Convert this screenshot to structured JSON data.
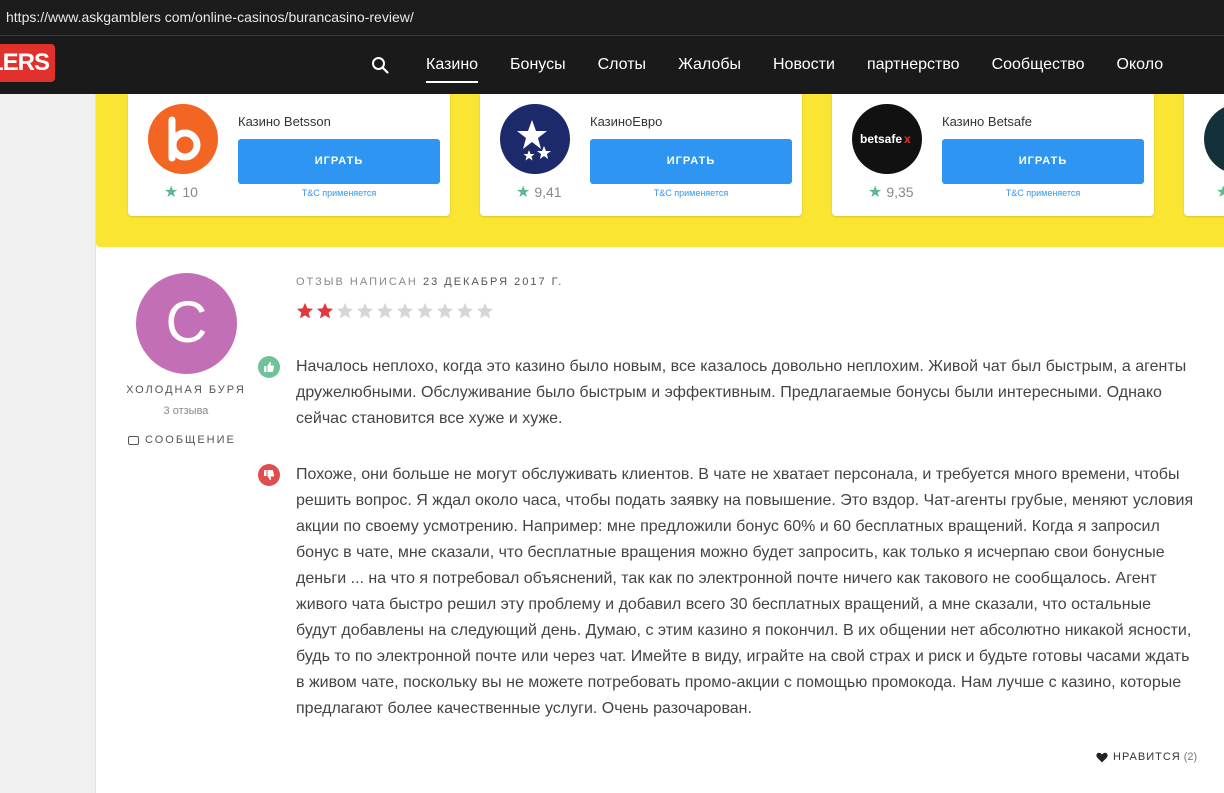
{
  "browser": {
    "url": "https://www.askgamblers com/online-casinos/burancasino-review/"
  },
  "header": {
    "logo_text": "LERS",
    "nav": [
      "Казино",
      "Бонусы",
      "Слоты",
      "Жалобы",
      "Новости",
      "партнерство",
      "Сообщество",
      "Около"
    ],
    "active": "Казино"
  },
  "casinos": [
    {
      "name": "Казино Betsson",
      "button": "ИГРАТЬ",
      "tc": "T&C применяется",
      "rating": "10",
      "logo_color": "#f26522"
    },
    {
      "name": "КазиноЕвро",
      "button": "ИГРАТЬ",
      "tc": "T&C применяется",
      "rating": "9,41",
      "logo_color": "#1c2a6b"
    },
    {
      "name": "Казино Betsafe",
      "button": "ИГРАТЬ",
      "tc": "T&C применяется",
      "rating": "9,35",
      "logo_color": "#111111",
      "logo_text": "betsafe"
    }
  ],
  "review": {
    "author": "ХОЛОДНАЯ БУРЯ",
    "avatar_letter": "C",
    "review_count": "3 отзыва",
    "message_label": "СООБЩЕНИЕ",
    "date_prefix": "ОТЗЫВ НАПИСАН",
    "date": "23 ДЕКАБРЯ 2017 Г.",
    "rating_stars": 2,
    "rating_max": 10,
    "pros": "Началось неплохо, когда это казино было новым, все казалось довольно неплохим. Живой чат был быстрым, а агенты дружелюбными. Обслуживание было быстрым и эффективным. Предлагаемые бонусы были интересными. Однако сейчас становится все хуже и хуже.",
    "cons": "Похоже, они больше не могут обслуживать клиентов. В чате не хватает персонала, и требуется много времени, чтобы решить вопрос. Я ждал около часа, чтобы подать заявку на повышение. Это вздор. Чат-агенты грубые, меняют условия акции по своему усмотрению. Например: мне предложили бонус 60% и 60 бесплатных вращений. Когда я запросил бонус в чате, мне сказали, что бесплатные вращения можно будет запросить, как только я исчерпаю свои бонусные деньги ... на что я потребовал объяснений, так как по электронной почте ничего как такового не сообщалось. Агент живого чата быстро решил эту проблему и добавил всего 30 бесплатных вращений, а мне сказали, что остальные будут добавлены на следующий день. Думаю, с этим казино я покончил. В их общении нет абсолютно никакой ясности, будь то по электронной почте или через чат. Имейте в виду, играйте на свой страх и риск и будьте готовы часами ждать в живом чате, поскольку вы не можете потребовать промо-акции с помощью промокода. Нам лучше с казино, которые предлагают более качественные услуги. Очень разочарован.",
    "like_label": "НРАВИТСЯ",
    "like_count": "(2)"
  },
  "colors": {
    "accent_yellow": "#fbe533",
    "button_blue": "#2f95f3",
    "star_red": "#e0383c",
    "star_grey": "#d6d6d6",
    "pro_green": "#6ec39a",
    "con_red": "#e04d50"
  }
}
